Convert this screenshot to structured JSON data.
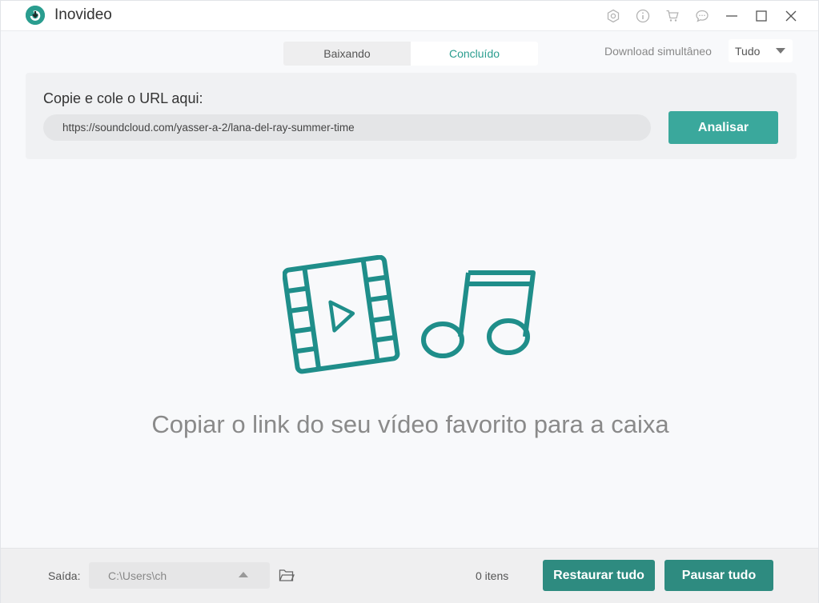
{
  "app": {
    "title": "Inovideo"
  },
  "tabs": [
    {
      "label": "Baixando",
      "active": false
    },
    {
      "label": "Concluído",
      "active": true
    }
  ],
  "simultaneous": {
    "label": "Download simultâneo",
    "value": "Tudo"
  },
  "url_panel": {
    "label": "Copie e cole o URL aqui:",
    "value": "https://soundcloud.com/yasser-a-2/lana-del-ray-summer-time",
    "analyze_label": "Analisar"
  },
  "empty_state": {
    "hint": "Copiar o link do seu vídeo favorito para a caixa"
  },
  "bottom": {
    "output_label": "Saída:",
    "output_path": "C:\\Users\\ch",
    "items_count": "0 itens",
    "restore_label": "Restaurar tudo",
    "pause_label": "Pausar tudo"
  },
  "colors": {
    "accent": "#2a9d8f",
    "button": "#3aa89c",
    "button_dark": "#2e8b80"
  },
  "icons": [
    "app-logo-icon",
    "settings-icon",
    "info-icon",
    "cart-icon",
    "feedback-icon",
    "minimize-icon",
    "maximize-icon",
    "close-icon",
    "dropdown-caret-icon",
    "folder-icon",
    "video-film-icon",
    "music-note-icon"
  ]
}
